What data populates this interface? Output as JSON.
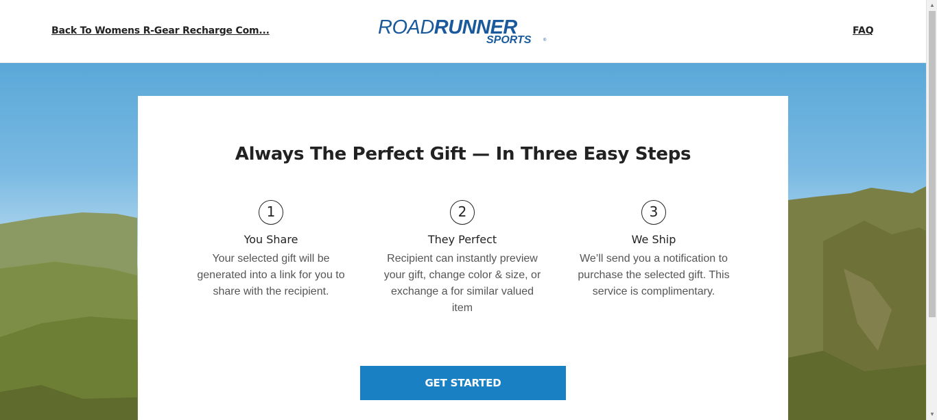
{
  "header": {
    "back_link": "Back To Womens R-Gear Recharge Com...",
    "faq_link": "FAQ",
    "logo_top": "ROADRUNNER",
    "logo_bottom": "SPORTS"
  },
  "colors": {
    "brand_blue": "#1a5a9c",
    "button_blue": "#1a80c4"
  },
  "card": {
    "headline": "Always The Perfect Gift — In Three Easy Steps",
    "steps": [
      {
        "number": "1",
        "title": "You Share",
        "lines": [
          "Your selected gift will be",
          "generated into a link for you to",
          "share with the recipient."
        ]
      },
      {
        "number": "2",
        "title": "They Perfect",
        "lines": [
          "Recipient can instantly preview",
          "your gift, change color & size, or",
          "exchange a for similar valued",
          "item"
        ]
      },
      {
        "number": "3",
        "title": "We Ship",
        "lines": [
          "We’ll send you a notification to",
          "purchase the selected gift. This",
          "service is complimentary."
        ]
      }
    ],
    "cta_label": "GET STARTED"
  },
  "icons": {
    "scroll_up": "scroll-up-arrow-icon",
    "scroll_down": "scroll-down-arrow-icon"
  }
}
